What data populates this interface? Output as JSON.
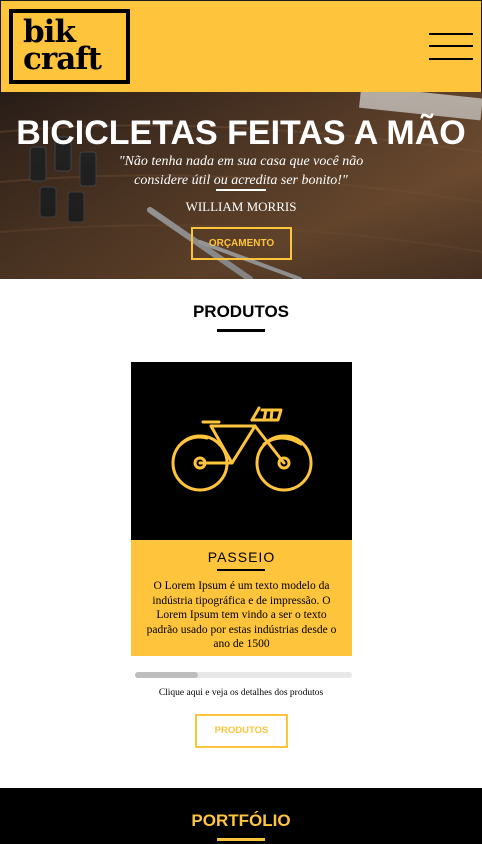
{
  "header": {
    "logo_line1": "bik",
    "logo_line2": "craft",
    "menu_icon": "hamburger-menu-icon",
    "background_color": "#FEC43C"
  },
  "hero": {
    "title": "BICICLETAS FEITAS A MÃO",
    "quote": "\"Não tenha nada em sua casa que você não considere útil ou acredita ser bonito!\"",
    "author": "WILLIAM MORRIS",
    "button_label": "ORÇAMENTO"
  },
  "products": {
    "title": "PRODUTOS",
    "card": {
      "icon": "bicycle-icon",
      "name": "PASSEIO",
      "description": "O Lorem Ipsum é um texto modelo da indústria tipográfica e de impressão. O Lorem Ipsum tem vindo a ser o texto padrão usado por estas indústrias desde o ano de 1500"
    },
    "hint": "Clique aqui e veja os detalhes dos produtos",
    "button_label": "PRODUTOS",
    "scroll_position": 0
  },
  "portfolio": {
    "title": "PORTFÓLIO"
  },
  "colors": {
    "accent": "#FEC43C",
    "dark": "#000000"
  }
}
